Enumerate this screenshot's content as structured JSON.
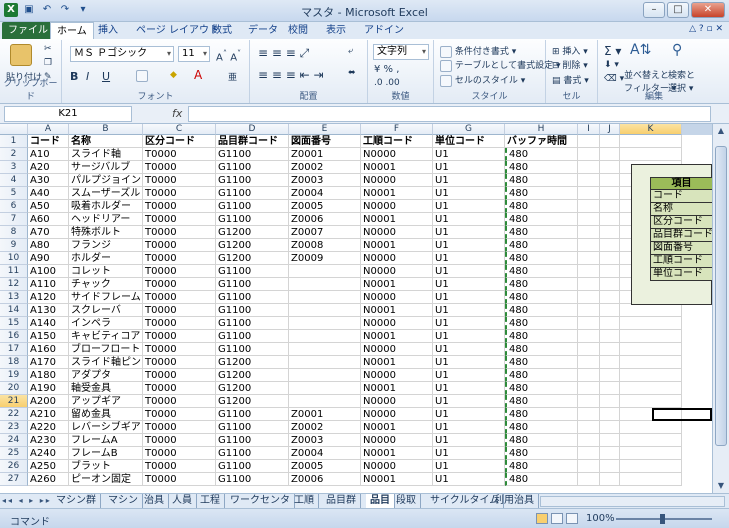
{
  "window": {
    "title": "マスタ - Microsoft Excel"
  },
  "ribbon_tabs": [
    "ファイル",
    "ホーム",
    "挿入",
    "ページ レイアウト",
    "数式",
    "データ",
    "校閲",
    "表示",
    "アドイン"
  ],
  "ribbon": {
    "clipboard": {
      "paste": "貼り付け",
      "label": "クリップボード"
    },
    "font": {
      "name": "ＭＳ Ｐゴシック",
      "size": "11",
      "label": "フォント"
    },
    "alignment": {
      "label": "配置"
    },
    "number": {
      "format": "文字列",
      "label": "数値"
    },
    "styles": {
      "conditional": "条件付き書式",
      "table": "テーブルとして書式設定",
      "cell": "セルのスタイル",
      "label": "スタイル"
    },
    "cells": {
      "insert": "挿入",
      "delete": "削除",
      "format": "書式",
      "label": "セル"
    },
    "editing": {
      "sort": "並べ替えと",
      "sort2": "フィルター",
      "find": "検索と",
      "find2": "選択",
      "label": "編集"
    }
  },
  "formula_bar": {
    "name_box": "K21",
    "fx": "fx",
    "formula": ""
  },
  "columns": [
    "A",
    "B",
    "C",
    "D",
    "E",
    "F",
    "G",
    "H",
    "I",
    "J",
    "K"
  ],
  "selected_column": "K",
  "selected_row": "21",
  "rows": [
    {
      "n": "1",
      "a": "コード",
      "b": "名称",
      "c": "区分コード",
      "d": "品目群コード",
      "e": "図面番号",
      "f": "工順コード",
      "g": "単位コード",
      "h": "バッファ時間"
    },
    {
      "n": "2",
      "a": "A10",
      "b": "スライド軸",
      "c": "T0000",
      "d": "G1100",
      "e": "Z0001",
      "f": "N0000",
      "g": "U1",
      "h": "480"
    },
    {
      "n": "3",
      "a": "A20",
      "b": "サージバルブ",
      "c": "T0000",
      "d": "G1100",
      "e": "Z0002",
      "f": "N0001",
      "g": "U1",
      "h": "480"
    },
    {
      "n": "4",
      "a": "A30",
      "b": "パルプジョイント",
      "c": "T0000",
      "d": "G1100",
      "e": "Z0003",
      "f": "N0000",
      "g": "U1",
      "h": "480"
    },
    {
      "n": "5",
      "a": "A40",
      "b": "スムーザーズル",
      "c": "T0000",
      "d": "G1100",
      "e": "Z0004",
      "f": "N0001",
      "g": "U1",
      "h": "480"
    },
    {
      "n": "6",
      "a": "A50",
      "b": "吸着ホルダー",
      "c": "T0000",
      "d": "G1100",
      "e": "Z0005",
      "f": "N0000",
      "g": "U1",
      "h": "480"
    },
    {
      "n": "7",
      "a": "A60",
      "b": "ヘッドリアー",
      "c": "T0000",
      "d": "G1100",
      "e": "Z0006",
      "f": "N0001",
      "g": "U1",
      "h": "480"
    },
    {
      "n": "8",
      "a": "A70",
      "b": "特殊ボルト",
      "c": "T0000",
      "d": "G1200",
      "e": "Z0007",
      "f": "N0000",
      "g": "U1",
      "h": "480"
    },
    {
      "n": "9",
      "a": "A80",
      "b": "フランジ",
      "c": "T0000",
      "d": "G1200",
      "e": "Z0008",
      "f": "N0001",
      "g": "U1",
      "h": "480"
    },
    {
      "n": "10",
      "a": "A90",
      "b": "ホルダー",
      "c": "T0000",
      "d": "G1200",
      "e": "Z0009",
      "f": "N0000",
      "g": "U1",
      "h": "480"
    },
    {
      "n": "11",
      "a": "A100",
      "b": "コレット",
      "c": "T0000",
      "d": "G1100",
      "e": "",
      "f": "N0000",
      "g": "U1",
      "h": "480"
    },
    {
      "n": "12",
      "a": "A110",
      "b": "チャック",
      "c": "T0000",
      "d": "G1100",
      "e": "",
      "f": "N0001",
      "g": "U1",
      "h": "480"
    },
    {
      "n": "13",
      "a": "A120",
      "b": "サイドフレーム",
      "c": "T0000",
      "d": "G1100",
      "e": "",
      "f": "N0000",
      "g": "U1",
      "h": "480"
    },
    {
      "n": "14",
      "a": "A130",
      "b": "スクレーバ",
      "c": "T0000",
      "d": "G1100",
      "e": "",
      "f": "N0001",
      "g": "U1",
      "h": "480"
    },
    {
      "n": "15",
      "a": "A140",
      "b": "インペラ",
      "c": "T0000",
      "d": "G1100",
      "e": "",
      "f": "N0000",
      "g": "U1",
      "h": "480"
    },
    {
      "n": "16",
      "a": "A150",
      "b": "キャビティコア",
      "c": "T0000",
      "d": "G1100",
      "e": "",
      "f": "N0001",
      "g": "U1",
      "h": "480"
    },
    {
      "n": "17",
      "a": "A160",
      "b": "ブローフロート",
      "c": "T0000",
      "d": "G1100",
      "e": "",
      "f": "N0000",
      "g": "U1",
      "h": "480"
    },
    {
      "n": "18",
      "a": "A170",
      "b": "スライド軸ピン",
      "c": "T0000",
      "d": "G1200",
      "e": "",
      "f": "N0001",
      "g": "U1",
      "h": "480"
    },
    {
      "n": "19",
      "a": "A180",
      "b": "アダプタ",
      "c": "T0000",
      "d": "G1200",
      "e": "",
      "f": "N0000",
      "g": "U1",
      "h": "480"
    },
    {
      "n": "20",
      "a": "A190",
      "b": "軸受金具",
      "c": "T0000",
      "d": "G1200",
      "e": "",
      "f": "N0001",
      "g": "U1",
      "h": "480"
    },
    {
      "n": "21",
      "a": "A200",
      "b": "アップギア",
      "c": "T0000",
      "d": "G1200",
      "e": "",
      "f": "N0000",
      "g": "U1",
      "h": "480"
    },
    {
      "n": "22",
      "a": "A210",
      "b": "留め金具",
      "c": "T0000",
      "d": "G1100",
      "e": "Z0001",
      "f": "N0000",
      "g": "U1",
      "h": "480"
    },
    {
      "n": "23",
      "a": "A220",
      "b": "レバーシブギア",
      "c": "T0000",
      "d": "G1100",
      "e": "Z0002",
      "f": "N0001",
      "g": "U1",
      "h": "480"
    },
    {
      "n": "24",
      "a": "A230",
      "b": "フレームA",
      "c": "T0000",
      "d": "G1100",
      "e": "Z0003",
      "f": "N0000",
      "g": "U1",
      "h": "480"
    },
    {
      "n": "25",
      "a": "A240",
      "b": "フレームB",
      "c": "T0000",
      "d": "G1100",
      "e": "Z0004",
      "f": "N0001",
      "g": "U1",
      "h": "480"
    },
    {
      "n": "26",
      "a": "A250",
      "b": "ブラット",
      "c": "T0000",
      "d": "G1100",
      "e": "Z0005",
      "f": "N0000",
      "g": "U1",
      "h": "480"
    },
    {
      "n": "27",
      "a": "A260",
      "b": "ピーオン固定",
      "c": "T0000",
      "d": "G1100",
      "e": "Z0006",
      "f": "N0001",
      "g": "U1",
      "h": "480"
    }
  ],
  "item_box": {
    "header": "項目",
    "items": [
      "コード",
      "名称",
      "区分コード",
      "品目群コード",
      "図面番号",
      "工順コード",
      "単位コード"
    ]
  },
  "sheet_tabs": [
    "マシン群",
    "マシン",
    "治具",
    "人員",
    "工程",
    "ワークセンタ",
    "工順",
    "品目群",
    "品目",
    "段取",
    "サイクルタイム",
    "利用治具"
  ],
  "active_sheet": "品目",
  "status": {
    "mode": "コマンド",
    "zoom": "100%"
  },
  "colors": {
    "accent_green": "#9bbb59",
    "box_fill": "#ebf1de",
    "selection": "#f8cf6f"
  }
}
